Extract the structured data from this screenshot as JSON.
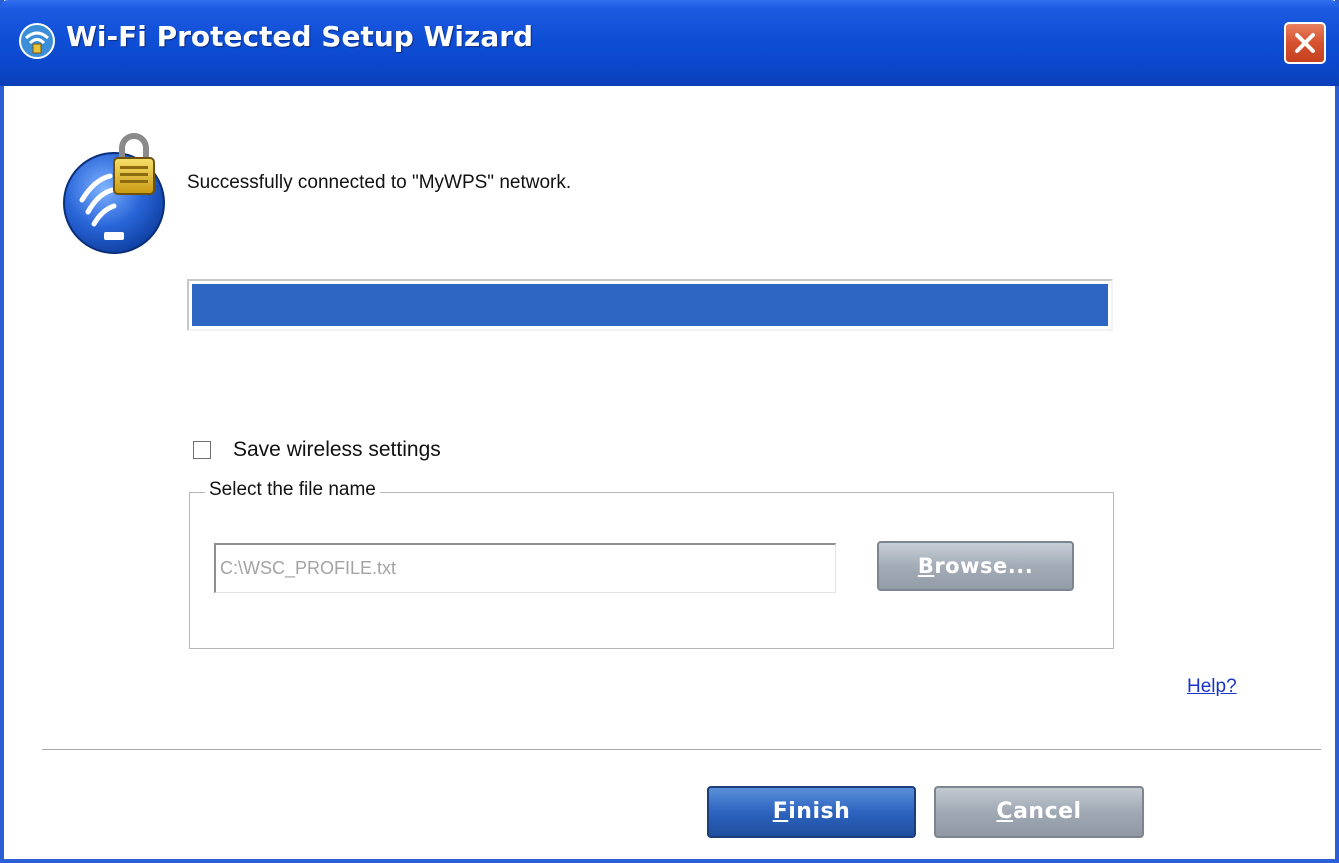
{
  "window": {
    "title": "Wi-Fi Protected Setup Wizard"
  },
  "status": {
    "message": "Successfully connected to \"MyWPS\" network.",
    "progress": 1.0
  },
  "save_settings": {
    "label": "Save wireless settings",
    "checked": false
  },
  "file_group": {
    "legend": "Select the file name",
    "file_value": "C:\\WSC_PROFILE.txt",
    "browse_hotkey": "B",
    "browse_rest": "rowse..."
  },
  "help": {
    "label": "Help?"
  },
  "footer": {
    "finish_hotkey": "F",
    "finish_rest": "inish",
    "cancel_hotkey": "C",
    "cancel_rest": "ancel"
  },
  "icons": {
    "app": "wps-app-icon",
    "logo": "wps-lock-logo",
    "close": "close-icon"
  },
  "colors": {
    "titlebar": "#0b46c9",
    "progress_fill": "#2d66c3",
    "close_button": "#d6512e",
    "primary_button": "#2d64bf",
    "secondary_button": "#a3acb7",
    "link": "#1a33cc"
  }
}
